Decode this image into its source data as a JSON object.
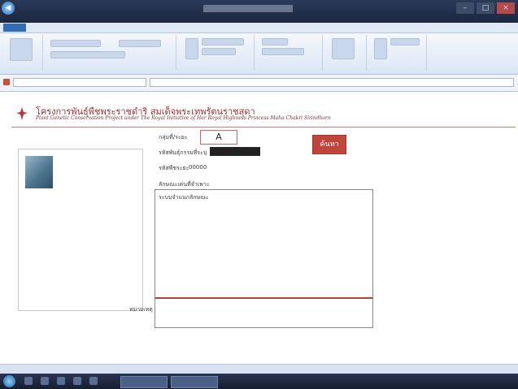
{
  "window": {
    "back_icon": "back-arrow-icon",
    "controls": [
      "–",
      "□",
      "×"
    ]
  },
  "menubar": {
    "file_tab": ""
  },
  "ribbon": {
    "groups": [
      "",
      "",
      "",
      "",
      "",
      ""
    ]
  },
  "address": {
    "location": "",
    "url": ""
  },
  "header": {
    "logo_icon": "royal-emblem-icon",
    "title_th": "โครงการพันธุ์พืชพระราชดำริ สมเด็จพระเทพรัตนราชสุดา",
    "subtitle_en": "Plant Genetic Conservation Project under The Royal Initiative of Her Royal Highness Princess Maha Chakri Sirindhorn"
  },
  "form": {
    "group_label": "กลุ่มที่/ระยะ",
    "group_value": "A",
    "sample_id_label": "รหัสพันธุ์กรรมที่ระบุ",
    "plant_number_label": "รหัสพืชระยะ",
    "plant_number_value": "00000",
    "description_label": "ลักษณะเด่นที่จำเพาะ",
    "description_value": "ระบบจำแนกลักษณะ",
    "note_label": "หมายเหตุ",
    "search_button": "ค้นหา"
  },
  "statusbar": {
    "text": ""
  },
  "colors": {
    "accent": "#c0463b",
    "title": "#9a2e2e"
  }
}
